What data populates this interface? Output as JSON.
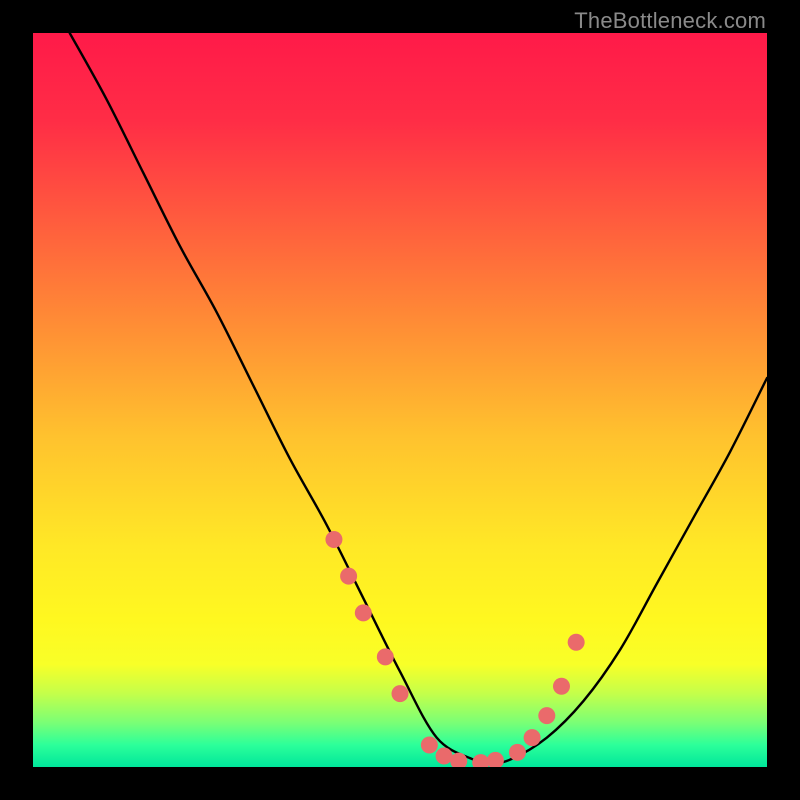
{
  "watermark": "TheBottleneck.com",
  "colors": {
    "curve": "#000000",
    "dots": "#ea6a6b"
  },
  "chart_data": {
    "type": "line",
    "title": "",
    "xlabel": "",
    "ylabel": "",
    "xlim": [
      0,
      100
    ],
    "ylim": [
      0,
      100
    ],
    "note": "x/y are read in percent of the plot area; y=100 is the top of the gradient, y=0 is the baseline. The curve traces a bottleneck-shaped valley; coral dots mark sampled points near the valley floor.",
    "series": [
      {
        "name": "bottleneck-curve",
        "x": [
          5,
          10,
          15,
          20,
          25,
          30,
          35,
          40,
          45,
          50,
          55,
          60,
          62,
          65,
          70,
          75,
          80,
          85,
          90,
          95,
          100
        ],
        "y": [
          100,
          91,
          81,
          71,
          62,
          52,
          42,
          33,
          23,
          13,
          4,
          1,
          0.5,
          1,
          4,
          9,
          16,
          25,
          34,
          43,
          53
        ]
      }
    ],
    "points": {
      "name": "sampled-dots",
      "x": [
        41,
        43,
        45,
        48,
        50,
        54,
        56,
        58,
        61,
        63,
        66,
        68,
        70,
        72,
        74
      ],
      "y": [
        31,
        26,
        21,
        15,
        10,
        3,
        1.5,
        0.8,
        0.6,
        0.9,
        2,
        4,
        7,
        11,
        17
      ]
    }
  }
}
